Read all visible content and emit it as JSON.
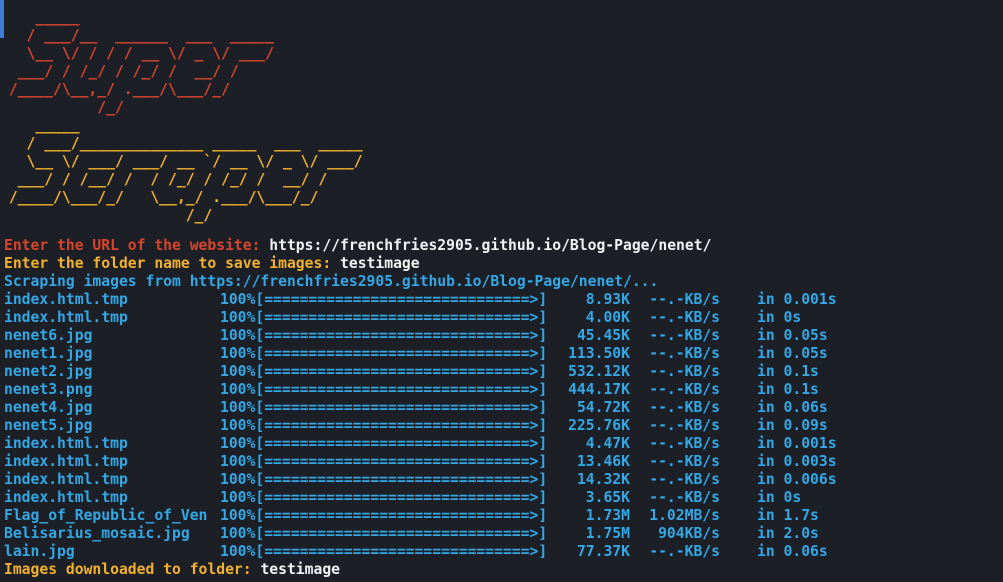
{
  "banner": {
    "title1_art": "    _____\n   / ___/__  ______  ___  _____\n   \\__ \\/ / / / __ \\/ _ \\/ ___/\n  ___/ / /_/ / /_/ /  __/ /\n /____/\\__,_/ .___/\\___/_/\n           /_/",
    "title2_art": "    _____\n   / ___/______________ _____  ___  _____\n   \\__ \\/ ___/ ___/ __ `/ __ \\/ _ \\/ ___/\n  ___/ / /__/ /  / /_/ / /_/ /  __/ /\n /____/\\___/_/   \\__,_/ .___/\\___/_/\n                     /_/"
  },
  "prompts": {
    "url_label": "Enter the URL of the website:",
    "url_value": "https://frenchfries2905.github.io/Blog-Page/nenet/",
    "folder_label": "Enter the folder name to save images:",
    "folder_value": "testimage",
    "scraping": "Scraping images from https://frenchfries2905.github.io/Blog-Page/nenet/..."
  },
  "downloads": [
    {
      "name": "index.html.tmp",
      "bar": "100%[==============================>]",
      "size": "8.93K",
      "speed": "--.-KB/s",
      "time": "in 0.001s"
    },
    {
      "name": "index.html.tmp",
      "bar": "100%[==============================>]",
      "size": "4.00K",
      "speed": "--.-KB/s",
      "time": "in 0s"
    },
    {
      "name": "nenet6.jpg",
      "bar": "100%[==============================>]",
      "size": "45.45K",
      "speed": "--.-KB/s",
      "time": "in 0.05s"
    },
    {
      "name": "nenet1.jpg",
      "bar": "100%[==============================>]",
      "size": "113.50K",
      "speed": "--.-KB/s",
      "time": "in 0.05s"
    },
    {
      "name": "nenet2.jpg",
      "bar": "100%[==============================>]",
      "size": "532.12K",
      "speed": "--.-KB/s",
      "time": "in 0.1s"
    },
    {
      "name": "nenet3.png",
      "bar": "100%[==============================>]",
      "size": "444.17K",
      "speed": "--.-KB/s",
      "time": "in 0.1s"
    },
    {
      "name": "nenet4.jpg",
      "bar": "100%[==============================>]",
      "size": "54.72K",
      "speed": "--.-KB/s",
      "time": "in 0.06s"
    },
    {
      "name": "nenet5.jpg",
      "bar": "100%[==============================>]",
      "size": "225.76K",
      "speed": "--.-KB/s",
      "time": "in 0.09s"
    },
    {
      "name": "index.html.tmp",
      "bar": "100%[==============================>]",
      "size": "4.47K",
      "speed": "--.-KB/s",
      "time": "in 0.001s"
    },
    {
      "name": "index.html.tmp",
      "bar": "100%[==============================>]",
      "size": "13.46K",
      "speed": "--.-KB/s",
      "time": "in 0.003s"
    },
    {
      "name": "index.html.tmp",
      "bar": "100%[==============================>]",
      "size": "14.32K",
      "speed": "--.-KB/s",
      "time": "in 0.006s"
    },
    {
      "name": "index.html.tmp",
      "bar": "100%[==============================>]",
      "size": "3.65K",
      "speed": "--.-KB/s",
      "time": "in 0s"
    },
    {
      "name": "Flag_of_Republic_of_Ven",
      "bar": "100%[==============================>]",
      "size": "1.73M",
      "speed": "1.02MB/s",
      "time": "in 1.7s"
    },
    {
      "name": "Belisarius_mosaic.jpg",
      "bar": "100%[==============================>]",
      "size": "1.75M",
      "speed": "904KB/s",
      "time": "in 2.0s"
    },
    {
      "name": "lain.jpg",
      "bar": "100%[==============================>]",
      "size": "77.37K",
      "speed": "--.-KB/s",
      "time": "in 0.06s"
    }
  ],
  "summary": {
    "label": "Images downloaded to folder:",
    "folder": "testimage"
  },
  "colors": {
    "background": "#1c1f26",
    "red": "#d8452d",
    "orange": "#f2b12f",
    "cyan": "#34a7e5",
    "white": "#f1f3f5"
  }
}
